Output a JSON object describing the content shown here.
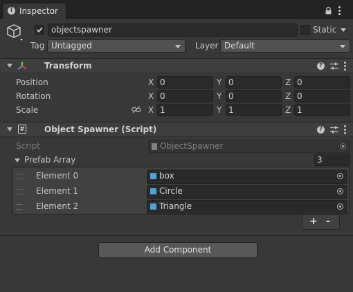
{
  "tab": {
    "title": "Inspector"
  },
  "object": {
    "active": true,
    "name": "objectspawner",
    "static_label": "Static",
    "tag_label": "Tag",
    "tag_value": "Untagged",
    "layer_label": "Layer",
    "layer_value": "Default"
  },
  "transform": {
    "title": "Transform",
    "rows": [
      {
        "label": "Position",
        "x": "0",
        "y": "0",
        "z": "0"
      },
      {
        "label": "Rotation",
        "x": "0",
        "y": "0",
        "z": "0"
      },
      {
        "label": "Scale",
        "x": "1",
        "y": "1",
        "z": "1"
      }
    ],
    "axis_x": "X",
    "axis_y": "Y",
    "axis_z": "Z"
  },
  "spawner": {
    "title": "Object Spawner (Script)",
    "script_label": "Script",
    "script_value": "ObjectSpawner",
    "array_label": "Prefab Array",
    "array_size": "3",
    "elements": [
      {
        "label": "Element 0",
        "value": "box"
      },
      {
        "label": "Element 1",
        "value": "Circle"
      },
      {
        "label": "Element 2",
        "value": "Triangle"
      }
    ],
    "add_symbol": "+",
    "remove_symbol": "-"
  },
  "add_component_label": "Add Component",
  "colors": {
    "background": "#383838",
    "header": "#3e3e3e",
    "field": "#2a2a2a",
    "prefab_icon": "#4da3d8",
    "transform_x": "#e0453c",
    "transform_y": "#6ccf4a",
    "transform_z": "#4a8fe0"
  },
  "icons": [
    "info-icon",
    "lock-icon",
    "kebab-menu-icon",
    "gameobject-cube-icon",
    "checkbox-check-icon",
    "dropdown-arrow-icon",
    "transform-icon",
    "help-icon",
    "preset-icon",
    "script-icon",
    "prefab-cube-icon",
    "object-picker-icon",
    "link-scale-icon",
    "drag-handle-icon"
  ]
}
